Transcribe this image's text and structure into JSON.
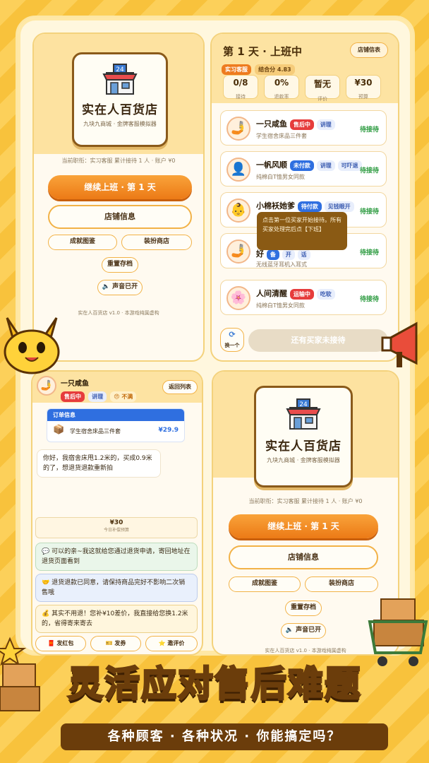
{
  "home": {
    "shop_sign": "24",
    "title": "实在人百货店",
    "subtitle": "九块九商城 · 金牌客服模拟器",
    "status_line": "当前职衔：实习客服 累计接待 1 人 · 账户 ¥0",
    "start_button": "继续上班 · 第 1 天",
    "info_button": "店铺信息",
    "achievements_button": "成就图鉴",
    "decor_shop_button": "装扮商店",
    "reset_button": "重置存档",
    "sound_button": "声音已开",
    "footer": "实在人百货店 v1.0 · 本游戏纯属虚构"
  },
  "shift": {
    "title": "第 1 天 · 上班中",
    "shop_info_button": "店铺信表",
    "rank_tag": "实习客服",
    "rating_tag": "结合分 4.83",
    "stats": [
      {
        "value": "0/8",
        "label": "接待"
      },
      {
        "value": "0%",
        "label": "退款率"
      },
      {
        "value": "暂无",
        "label": "评价"
      },
      {
        "value": "¥30",
        "label": "预算"
      }
    ],
    "customers": [
      {
        "name": "一只咸鱼",
        "tags": [
          "售后中",
          "讲理"
        ],
        "desc": "学生宿舍床品三件套",
        "status": "待接待",
        "avatar": "🤳"
      },
      {
        "name": "一帆风顺",
        "tags": [
          "未付款",
          "讲理",
          "可吓退"
        ],
        "desc": "纯棉白T恤男女同款",
        "status": "待接待",
        "avatar": "👤"
      },
      {
        "name": "小棉袄她爹",
        "tags": [
          "待付款",
          "见钱眼开"
        ],
        "desc": "",
        "status": "待接待",
        "avatar": "👶"
      },
      {
        "name": "好",
        "tags": [
          "备",
          "开",
          "话"
        ],
        "desc": "无线蓝牙耳机入耳式",
        "status": "待接待",
        "avatar": "🤳"
      },
      {
        "name": "人间清醒",
        "tags": [
          "运输中",
          "吃软"
        ],
        "desc": "纯棉白T恤男女同款",
        "status": "待接待",
        "avatar": "🌸"
      }
    ],
    "tooltip": "点击第一位买家开始接待。所有买家处理完后点【下班】",
    "switch_label": "换一个",
    "remaining_button": "还有买家未接待"
  },
  "chat": {
    "customer_name": "一只咸鱼",
    "tags": [
      "售后中",
      "讲理",
      "😠 不满"
    ],
    "back_button": "返回列表",
    "order_header": "订单信息",
    "order_item": "学生宿舍床品三件套",
    "order_price": "¥29.9",
    "customer_message": "你好，我宿舍床甩1.2米的，买成0.9米的了，想退货退款重新拍",
    "budget_value": "¥30",
    "budget_label": "今日补偿预算",
    "options": [
      "💬 可以的亲~我这就给您通过退货申请，寄回地址在退货页面看到",
      "🤝 退货退款已同意，请保持商品完好不影响二次销售哦",
      "💰 其实不用退！您补¥10差价，我直接给您换1.2米的，省得寄来寄去"
    ],
    "actions": [
      "🧧 发红包",
      "🎫 发券",
      "⭐ 邀评价"
    ]
  },
  "banner": {
    "headline": "灵活应对售后难题",
    "subline": "各种顾客 · 各种状况 · 你能搞定吗？"
  },
  "colors": {
    "accent": "#ec7a16",
    "bg": "#fbc948",
    "brown": "#6b3d0b"
  }
}
